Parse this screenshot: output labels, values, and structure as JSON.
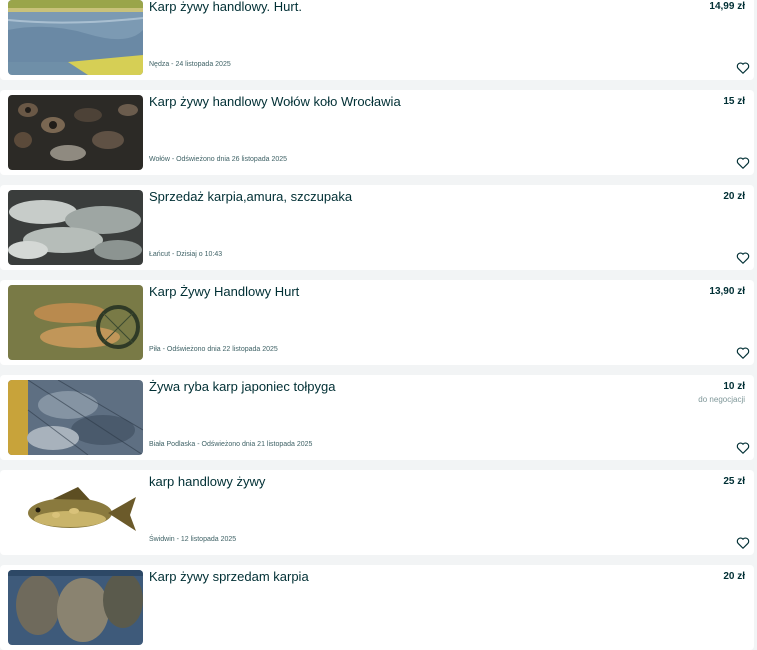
{
  "listings": [
    {
      "title": "Karp żywy handlowy. Hurt.",
      "price": "14,99 zł",
      "negotiable": "",
      "meta": "Nędza - 24 listopada 2025",
      "image": "pond-water-photo"
    },
    {
      "title": "Karp żywy handlowy Wołów koło Wrocławia",
      "price": "15 zł",
      "negotiable": "",
      "meta": "Wołów - Odświeżono dnia 26 listopada 2025",
      "image": "carp-swarm-photo"
    },
    {
      "title": "Sprzedaż karpia,amura, szczupaka",
      "price": "20 zł",
      "negotiable": "",
      "meta": "Łańcut - Dzisiaj o 10:43",
      "image": "fish-pile-photo"
    },
    {
      "title": "Karp Żywy Handlowy Hurt",
      "price": "13,90 zł",
      "negotiable": "",
      "meta": "Piła - Odświeżono dnia 22 listopada 2025",
      "image": "carp-on-grass-photo"
    },
    {
      "title": "Żywa ryba karp japoniec tołpyga",
      "price": "10 zł",
      "negotiable": "do negocjacji",
      "meta": "Biała Podlaska - Odświeżono dnia 21 listopada 2025",
      "image": "fish-in-net-photo"
    },
    {
      "title": "karp handlowy żywy",
      "price": "25 zł",
      "negotiable": "",
      "meta": "Świdwin - 12 listopada 2025",
      "image": "single-carp-photo"
    },
    {
      "title": "Karp żywy sprzedam karpia",
      "price": "20 zł",
      "negotiable": "",
      "meta": "",
      "image": "carp-in-crate-photo"
    }
  ]
}
